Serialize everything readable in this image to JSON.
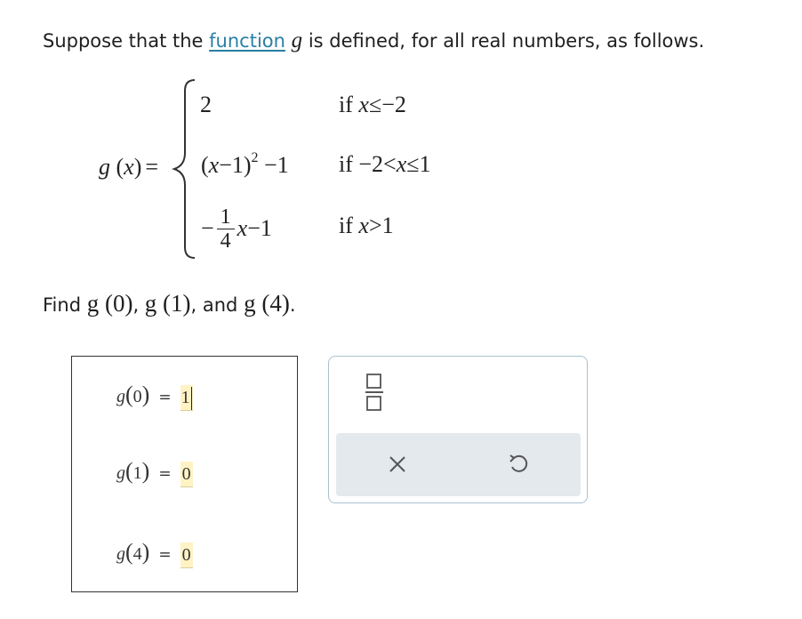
{
  "prompt": {
    "before_link": "Suppose that the ",
    "link_text": "function",
    "var": "g",
    "after_var": " is defined, for all real numbers, as follows."
  },
  "piecewise": {
    "lhs": "g (x) =",
    "cases": [
      {
        "expr": "2",
        "condition": "if x ≤ −2"
      },
      {
        "expr": "(x − 1)² − 1",
        "condition": "if −2 < x ≤ 1"
      },
      {
        "expr": "−(1/4) x − 1",
        "condition": "if x > 1"
      }
    ]
  },
  "find": {
    "prefix": "Find ",
    "items": [
      "g (0)",
      "g (1)",
      "g (4)"
    ],
    "sep1": ", ",
    "sep2": ", and ",
    "suffix": "."
  },
  "answers": [
    {
      "label": "g(0)",
      "value": "1",
      "focused": true
    },
    {
      "label": "g(1)",
      "value": "0",
      "focused": false
    },
    {
      "label": "g(4)",
      "value": "0",
      "focused": false
    }
  ],
  "tools": {
    "fraction": "fraction-icon",
    "clear": "×",
    "undo": "undo-icon"
  },
  "colors": {
    "link": "#2a7fa6",
    "input_highlight": "#fff3c4",
    "panel_border": "#a9c2d0",
    "action_bar": "#e3e9ed"
  }
}
